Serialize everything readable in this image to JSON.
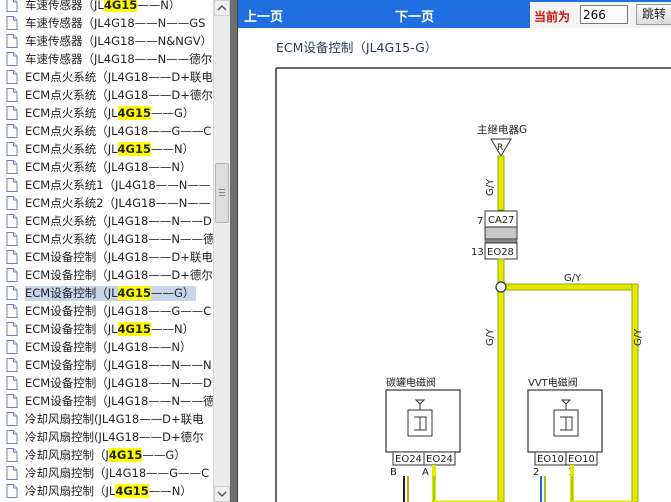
{
  "tree": {
    "items": [
      {
        "text": "车速传感器（JL",
        "hl": "4G15",
        "post": "——N）",
        "selected": false
      },
      {
        "text": "车速传感器（JL4G18——N——GS",
        "hl": "",
        "post": "",
        "selected": false
      },
      {
        "text": "车速传感器（JL4G18——N&NGV）",
        "hl": "",
        "post": "",
        "selected": false
      },
      {
        "text": "车速传感器（JL4G18——N——德尔",
        "hl": "",
        "post": "",
        "selected": false
      },
      {
        "text": "ECM点火系统（JL4G18——D+联电",
        "hl": "",
        "post": "",
        "selected": false
      },
      {
        "text": "ECM点火系统（JL4G18——D+德尔",
        "hl": "",
        "post": "",
        "selected": false
      },
      {
        "text": "ECM点火系统（JL",
        "hl": "4G15",
        "post": "——G）",
        "selected": false
      },
      {
        "text": "ECM点火系统（JL4G18——G——C",
        "hl": "",
        "post": "",
        "selected": false
      },
      {
        "text": "ECM点火系统（JL",
        "hl": "4G15",
        "post": "——N）",
        "selected": false
      },
      {
        "text": "ECM点火系统（JL4G18——N）",
        "hl": "",
        "post": "",
        "selected": false
      },
      {
        "text": "ECM点火系统1（JL4G18——N——",
        "hl": "",
        "post": "",
        "selected": false
      },
      {
        "text": "ECM点火系统2（JL4G18——N——",
        "hl": "",
        "post": "",
        "selected": false
      },
      {
        "text": "ECM点火系统（JL4G18——N——D",
        "hl": "",
        "post": "",
        "selected": false
      },
      {
        "text": "ECM点火系统（JL4G18——N——德",
        "hl": "",
        "post": "",
        "selected": false
      },
      {
        "text": "ECM设备控制（JL4G18——D+联电",
        "hl": "",
        "post": "",
        "selected": false
      },
      {
        "text": "ECM设备控制（JL4G18——D+德尔",
        "hl": "",
        "post": "",
        "selected": false
      },
      {
        "text": "ECM设备控制（JL",
        "hl": "4G15",
        "post": "——G）",
        "selected": true
      },
      {
        "text": "ECM设备控制（JL4G18——G——C",
        "hl": "",
        "post": "",
        "selected": false
      },
      {
        "text": "ECM设备控制（JL",
        "hl": "4G15",
        "post": "——N）",
        "selected": false
      },
      {
        "text": "ECM设备控制（JL4G18——N）",
        "hl": "",
        "post": "",
        "selected": false
      },
      {
        "text": "ECM设备控制（JL4G18——N——N",
        "hl": "",
        "post": "",
        "selected": false
      },
      {
        "text": "ECM设备控制（JL4G18——N——D",
        "hl": "",
        "post": "",
        "selected": false
      },
      {
        "text": "ECM设备控制（JL4G18——N——德",
        "hl": "",
        "post": "",
        "selected": false
      },
      {
        "text": "冷却风扇控制(JL4G18——D+联电",
        "hl": "",
        "post": "",
        "selected": false
      },
      {
        "text": "冷却风扇控制(JL4G18——D+德尔",
        "hl": "",
        "post": "",
        "selected": false
      },
      {
        "text": "冷却风扇控制（J",
        "hl": "4G15",
        "post": "——G）",
        "selected": false
      },
      {
        "text": "冷却风扇控制（JL4G18——G——C",
        "hl": "",
        "post": "",
        "selected": false
      },
      {
        "text": "冷却风扇控制（JL",
        "hl": "4G15",
        "post": "——N）",
        "selected": false
      }
    ]
  },
  "nav": {
    "prev_label": "上一页",
    "next_label": "下一页",
    "current_label": "当前为",
    "page_value": "266",
    "jump_label": "跳转"
  },
  "diagram": {
    "title": "ECM设备控制（JL4G15-G）",
    "relay_label": "主继电器G",
    "relay_pin": "R",
    "wire_gy": "G/Y",
    "conn_top_num": "7",
    "conn_top_name": "CA27",
    "conn_bot_num": "13",
    "conn_bot_name": "EO28",
    "left_component": "碳罐电磁阀",
    "right_component": "VVT电磁阀",
    "left_conn_a": "EO24",
    "left_conn_b": "EO24",
    "left_pin_b": "B",
    "left_pin_a": "A",
    "right_conn_a": "EO10",
    "right_conn_b": "EO10",
    "right_pin_2": "2",
    "right_pin_1": "1"
  },
  "colors": {
    "nav_blue": "#1f6fe0",
    "highlight": "#ffff00",
    "wire_green": "#9ecb1a",
    "wire_yellow": "#e6e600",
    "selected_bg": "#c8d4ea"
  }
}
